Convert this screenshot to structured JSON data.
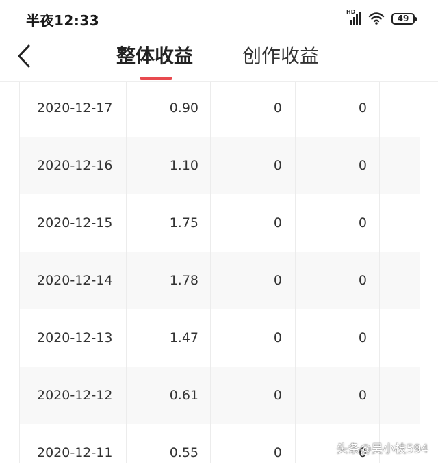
{
  "status_bar": {
    "time": "半夜12:33",
    "battery": "49",
    "network_label": "HD",
    "icons": [
      "signal-icon",
      "wifi-icon",
      "battery-icon"
    ]
  },
  "nav": {
    "tabs": [
      {
        "label": "整体收益",
        "active": true
      },
      {
        "label": "创作收益",
        "active": false
      }
    ],
    "accent_color": "#e84a4f"
  },
  "table": {
    "rows": [
      {
        "date": "2020-12-17",
        "income": "0.90",
        "col3": "0",
        "col4": "0"
      },
      {
        "date": "2020-12-16",
        "income": "1.10",
        "col3": "0",
        "col4": "0"
      },
      {
        "date": "2020-12-15",
        "income": "1.75",
        "col3": "0",
        "col4": "0"
      },
      {
        "date": "2020-12-14",
        "income": "1.78",
        "col3": "0",
        "col4": "0"
      },
      {
        "date": "2020-12-13",
        "income": "1.47",
        "col3": "0",
        "col4": "0"
      },
      {
        "date": "2020-12-12",
        "income": "0.61",
        "col3": "0",
        "col4": "0"
      },
      {
        "date": "2020-12-11",
        "income": "0.55",
        "col3": "0",
        "col4": "0"
      }
    ]
  },
  "watermark": "头条@吴小枝594"
}
